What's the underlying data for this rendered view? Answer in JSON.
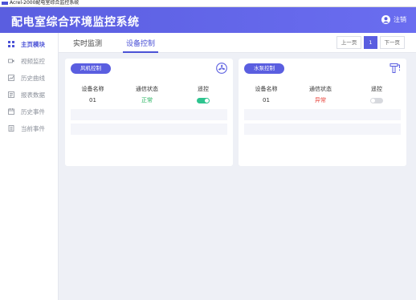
{
  "window": {
    "title": "Acrel-2000配电室综合监控系统"
  },
  "header": {
    "app_title": "配电室综合环境监控系统",
    "logout_label": "注销"
  },
  "sidebar": {
    "items": [
      {
        "label": "主页模块",
        "icon": "grid-icon",
        "active": true
      },
      {
        "label": "视频监控",
        "icon": "camera-icon",
        "active": false
      },
      {
        "label": "历史曲线",
        "icon": "chart-icon",
        "active": false
      },
      {
        "label": "报表数据",
        "icon": "report-icon",
        "active": false
      },
      {
        "label": "历史事件",
        "icon": "history-icon",
        "active": false
      },
      {
        "label": "当前事件",
        "icon": "event-icon",
        "active": false
      }
    ]
  },
  "tabs": [
    {
      "label": "实时监测",
      "active": false
    },
    {
      "label": "设备控制",
      "active": true
    }
  ],
  "pager": {
    "prev": "上一页",
    "page": "1",
    "next": "下一页"
  },
  "cards": [
    {
      "title": "风机控制",
      "icon": "fan-icon",
      "columns": [
        "设备名称",
        "通信状态",
        "遥控"
      ],
      "rows": [
        {
          "name": "01",
          "status": "正常",
          "status_kind": "ok",
          "toggle": true
        }
      ]
    },
    {
      "title": "水泵控制",
      "icon": "pump-icon",
      "columns": [
        "设备名称",
        "通信状态",
        "遥控"
      ],
      "rows": [
        {
          "name": "01",
          "status": "异常",
          "status_kind": "bad",
          "toggle": false
        }
      ]
    }
  ],
  "colors": {
    "accent": "#5a5ee0",
    "ok": "#27b35f",
    "bad": "#e8453c",
    "toggle_on": "#2ec48f",
    "toggle_off": "#d7d9de"
  }
}
